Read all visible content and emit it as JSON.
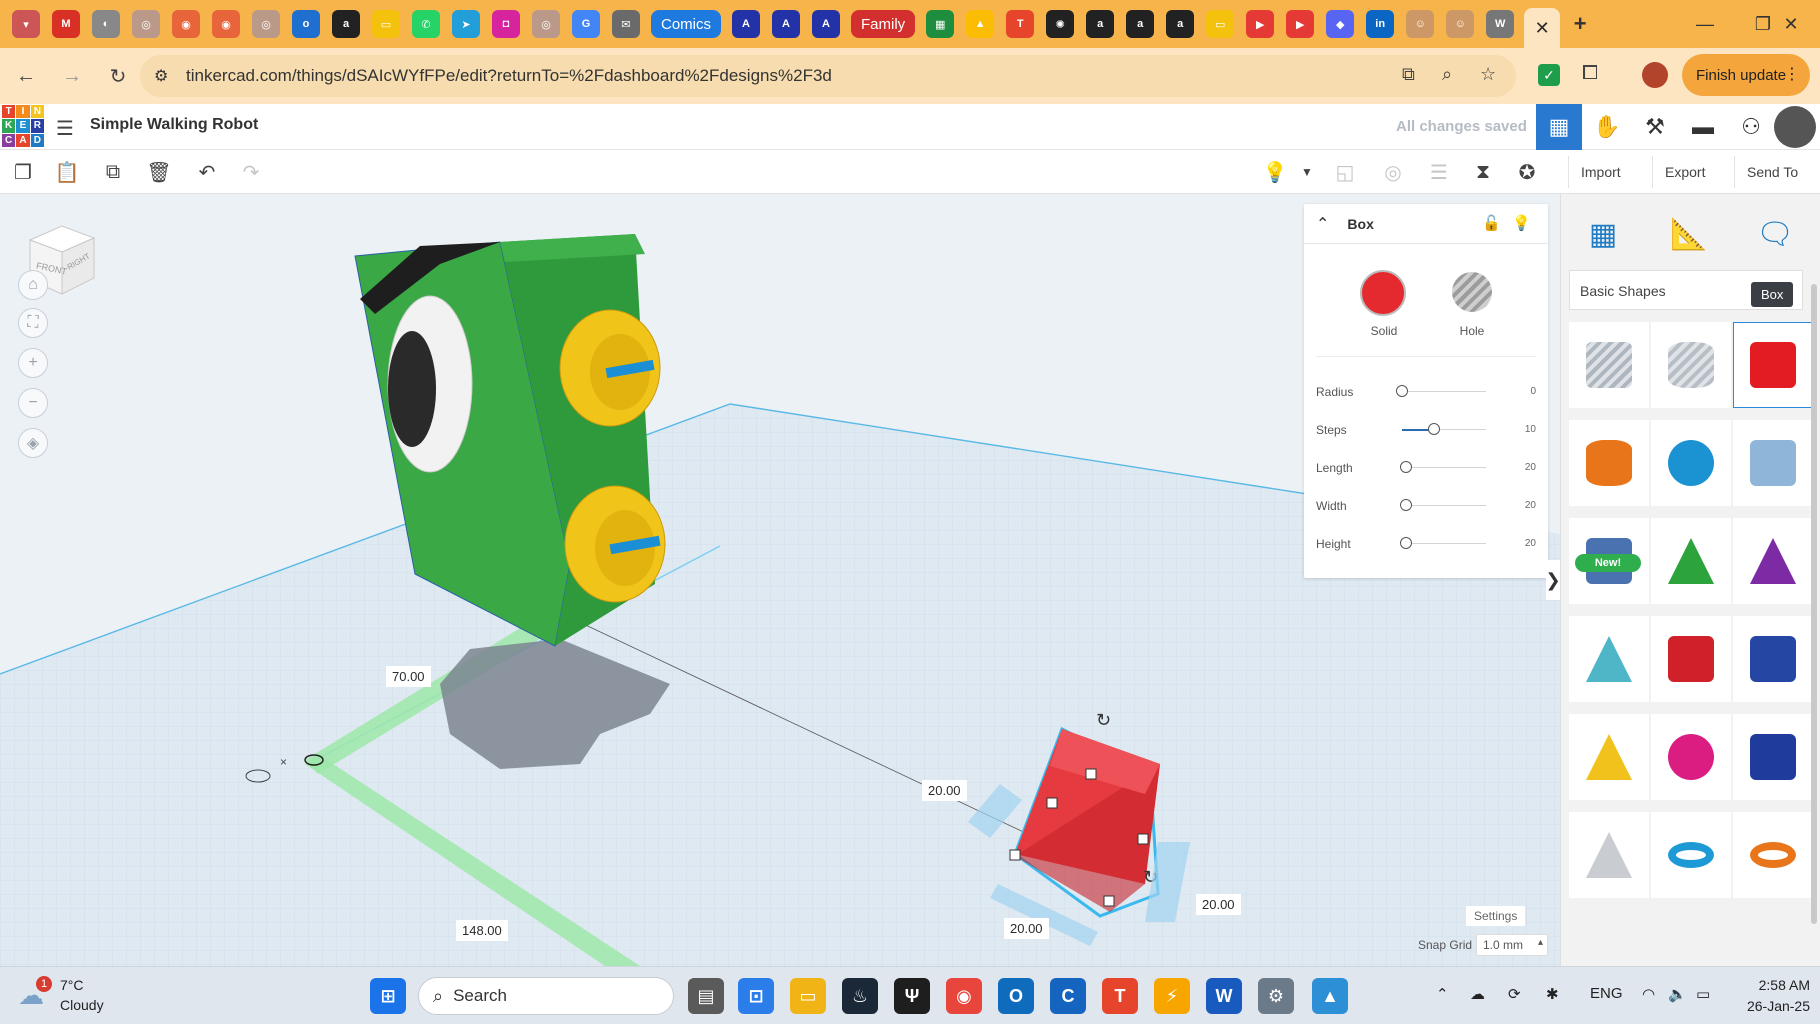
{
  "browser": {
    "pinned_tab_labels": [
      "Comics",
      "Family"
    ],
    "address": "tinkercad.com/things/dSAIcWYfFPe/edit?returnTo=%2Fdashboard%2Fdesigns%2F3d",
    "finish_update": "Finish update"
  },
  "app": {
    "logo_letters": [
      "T",
      "I",
      "N",
      "K",
      "E",
      "R",
      "C",
      "A",
      "D"
    ],
    "logo_colors": [
      "#e6452b",
      "#f28b1c",
      "#f6c422",
      "#2ea655",
      "#1e90d2",
      "#283fa5",
      "#8b3d9f",
      "#e6452b",
      "#1f7cc4"
    ],
    "design_title": "Simple Walking Robot",
    "save_status": "All changes saved"
  },
  "toolbar": {
    "import": "Import",
    "export": "Export",
    "send_to": "Send To"
  },
  "viewcube": {
    "front": "FRONT",
    "right": "RIGHT"
  },
  "inspector": {
    "title": "Box",
    "solid_label": "Solid",
    "hole_label": "Hole",
    "solid_color": "#e52a2f",
    "properties": [
      {
        "label": "Radius",
        "value": "0",
        "level": 0.0
      },
      {
        "label": "Steps",
        "value": "10",
        "level": 0.38
      },
      {
        "label": "Length",
        "value": "20",
        "level": 0.05
      },
      {
        "label": "Width",
        "value": "20",
        "level": 0.05
      },
      {
        "label": "Height",
        "value": "20",
        "level": 0.05
      }
    ]
  },
  "workplane": {
    "dimensions": {
      "ruler_x": "70.00",
      "ruler_y": "148.00",
      "box_length": "20.00",
      "box_width": "20.00",
      "box_height": "20.00"
    },
    "settings_label": "Settings",
    "snap_grid_label": "Snap Grid",
    "snap_grid_value": "1.0 mm"
  },
  "shapes_panel": {
    "library": "Basic Shapes",
    "tooltip": "Box",
    "new_badge": "New!",
    "shapes": [
      {
        "name": "box-hole-shape",
        "color": "#aeb6bf"
      },
      {
        "name": "cylinder-hole-shape",
        "color": "#b8bec6"
      },
      {
        "name": "box-shape",
        "color": "#e31b23"
      },
      {
        "name": "cylinder-shape",
        "color": "#e8751a"
      },
      {
        "name": "sphere-shape",
        "color": "#1b92d1"
      },
      {
        "name": "scribble-shape",
        "color": "#8fb5d8"
      },
      {
        "name": "shape-generator-shape",
        "color": "#4a72b0"
      },
      {
        "name": "roof-shape",
        "color": "#2ca33b"
      },
      {
        "name": "cone-shape",
        "color": "#7d2aa5"
      },
      {
        "name": "round-roof-shape",
        "color": "#4eb6c7"
      },
      {
        "name": "text-shape",
        "color": "#d0202a"
      },
      {
        "name": "wedge-shape",
        "color": "#2546a3"
      },
      {
        "name": "pyramid-shape",
        "color": "#f1c21b"
      },
      {
        "name": "half-sphere-shape",
        "color": "#db1d82"
      },
      {
        "name": "polygon-shape",
        "color": "#1f3c9c"
      },
      {
        "name": "paraboloid-shape",
        "color": "#c9cdd2"
      },
      {
        "name": "torus-shape",
        "color": "#1d9ad6"
      },
      {
        "name": "tube-shape",
        "color": "#e8751a"
      }
    ]
  },
  "taskbar": {
    "notification_count": "1",
    "temperature": "7°C",
    "condition": "Cloudy",
    "search": "Search",
    "language": "ENG",
    "time": "2:58 AM",
    "date": "26-Jan-25"
  }
}
